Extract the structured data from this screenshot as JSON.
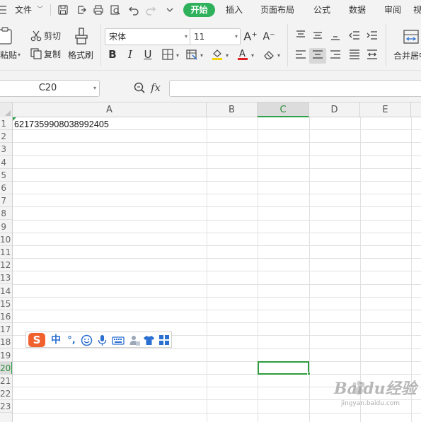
{
  "menubar": {
    "file_label": "文件",
    "tabs": [
      "开始",
      "插入",
      "页面布局",
      "公式",
      "数据",
      "审阅",
      "视"
    ],
    "active_tab": "开始"
  },
  "ribbon": {
    "paste_label": "粘贴",
    "cut_label": "剪切",
    "copy_label": "复制",
    "format_painter_label": "格式刷",
    "font_name": "宋体",
    "font_size": "11",
    "grow_font": "A⁺",
    "shrink_font": "A⁻",
    "bold": "B",
    "italic": "I",
    "underline": "U",
    "merge_center_label": "合并居中"
  },
  "formula_bar": {
    "name_box": "C20",
    "fx_label": "fx",
    "formula_value": ""
  },
  "grid": {
    "columns": [
      "A",
      "B",
      "C",
      "D",
      "E"
    ],
    "active_column": "C",
    "rows": [
      "1",
      "2",
      "3",
      "4",
      "5",
      "6",
      "7",
      "8",
      "9",
      "10",
      "11",
      "12",
      "13",
      "14",
      "15",
      "16",
      "17",
      "18",
      "19",
      "20",
      "21",
      "22",
      "23"
    ],
    "active_row": "20",
    "cell_a1": "6217359908038992405",
    "selected_cell": "C20"
  },
  "ime_toolbar": {
    "logo": "S",
    "mode": "中",
    "punct": "°,"
  },
  "watermark": {
    "text": "Baidu经验",
    "sub": "jingyan.baidu.com"
  },
  "colors": {
    "accent_green": "#2fb15c",
    "selection_green": "#2e9b3e",
    "ime_logo": "#f0612d",
    "ime_blue": "#2a6fd1"
  }
}
